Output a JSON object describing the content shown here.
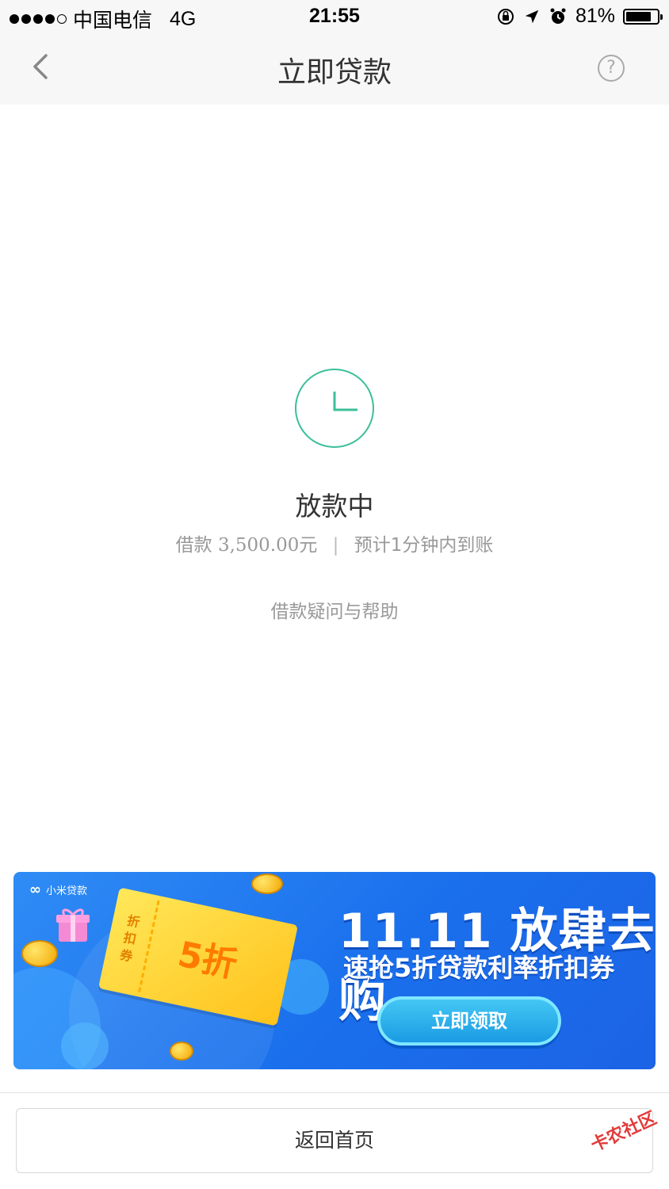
{
  "statusbar": {
    "carrier": "中国电信",
    "network": "4G",
    "time": "21:55",
    "battery": "81%",
    "battery_level": 0.81,
    "signal_bars_filled": 4,
    "signal_bars_total": 5,
    "icons": [
      "rotation-lock-icon",
      "location-arrow-icon",
      "alarm-icon",
      "battery-icon"
    ]
  },
  "nav": {
    "title": "立即贷款",
    "back_icon": "chevron-left-icon",
    "help_label": "?"
  },
  "status": {
    "icon": "clock-icon",
    "accent_color": "#3bbf9a",
    "title": "放款中",
    "amount_label": "借款",
    "amount": "3,500.00元",
    "separator": "|",
    "eta": "预计1分钟内到账",
    "help_link": "借款疑问与帮助"
  },
  "banner": {
    "brand": "小米贷款",
    "title": "11.11 放肆去购",
    "subtitle": "速抢5折贷款利率折扣券",
    "coupon_side": "折扣券",
    "coupon_main": "5折",
    "button": "立即领取",
    "colors": {
      "background": "#1a6fec",
      "button": "#1a9be4",
      "coupon": "#ffd233"
    }
  },
  "footer": {
    "home_button": "返回首页"
  },
  "watermark": "卡农社区"
}
